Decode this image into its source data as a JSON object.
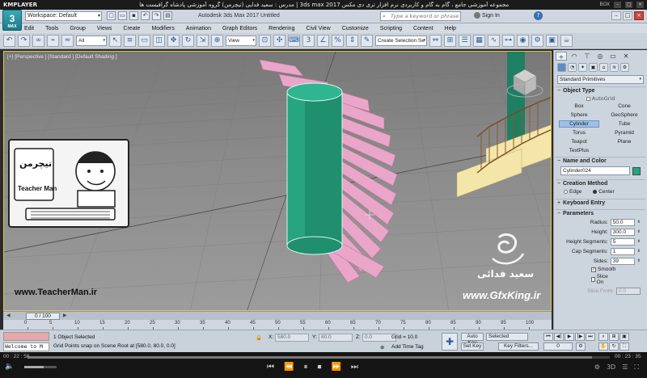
{
  "player": {
    "name": "KMPLAYER",
    "title": "مجموعه آموزشی جامع ، گام به گام و کاربردی نرم افزار تری دی مکس 3ds max 2017 | مدرس : سعید فدایی (تیچرمن) گروه آموزشی پادشاه گرافیست ها",
    "box_label": "BOX",
    "elapsed": "00 : 22 : 58",
    "total": "00 : 23 : 35",
    "progress": 0.97
  },
  "max": {
    "logo": "3",
    "logo_sub": "MAX",
    "workspace": "Workspace: Default",
    "app_title": "Autodesk 3ds Max 2017      Untitled",
    "search_placeholder": "Type a keyword or phrase",
    "sign_in": "Sign In"
  },
  "menu": [
    "Edit",
    "Tools",
    "Group",
    "Views",
    "Create",
    "Modifiers",
    "Animation",
    "Graph Editors",
    "Rendering",
    "Civil View",
    "Customize",
    "Scripting",
    "Content",
    "Help"
  ],
  "toolbar": {
    "filter": "All",
    "ref_coord": "View",
    "selection_set": "Create Selection Se"
  },
  "viewport": {
    "label": "[+] [Perspective ] [Standard ] [Default Shading ]"
  },
  "watermark": {
    "card_brand": "تیچرمن",
    "card_title": "Teacher Man",
    "url_left": "www.TeacherMan.ir",
    "name_right": "سعید فدائی",
    "url_right": "www.GfxKing.ir"
  },
  "panel": {
    "category": "Standard Primitives",
    "object_type_title": "Object Type",
    "autogrid": "AutoGrid",
    "primitives": [
      "Box",
      "Cone",
      "Sphere",
      "GeoSphere",
      "Cylinder",
      "Tube",
      "Torus",
      "Pyramid",
      "Teapot",
      "Plane",
      "TextPlus"
    ],
    "selected_primitive": "Cylinder",
    "name_color_title": "Name and Color",
    "object_name": "Cylinder024",
    "object_color": "#1fa784",
    "creation_method_title": "Creation Method",
    "creation_edge": "Edge",
    "creation_center": "Center",
    "keyboard_entry_title": "Keyboard Entry",
    "parameters_title": "Parameters",
    "params": [
      {
        "label": "Radius:",
        "value": "50.0"
      },
      {
        "label": "Height:",
        "value": "300.0"
      },
      {
        "label": "Height Segments:",
        "value": "5"
      },
      {
        "label": "Cap Segments:",
        "value": "1"
      },
      {
        "label": "Sides:",
        "value": "39"
      }
    ],
    "smooth": "Smooth",
    "slice_on": "Slice On",
    "slice_from_label": "Slice From:",
    "slice_from_value": "0.0"
  },
  "timeline": {
    "frame": "0 / 100",
    "ticks": [
      "0",
      "5",
      "10",
      "15",
      "20",
      "25",
      "30",
      "35",
      "40",
      "45",
      "50",
      "55",
      "60",
      "65",
      "70",
      "75",
      "80",
      "85",
      "90",
      "95",
      "100"
    ]
  },
  "status": {
    "maxscript_text": "Welcome to M",
    "selected": "1 Object Selected",
    "prompt": "Grid Points snap on Scene Root at [580.0, 80.0, 0.0]",
    "x_label": "X:",
    "x_value": "580.0",
    "y_label": "Y:",
    "y_value": "80.0",
    "z_label": "Z:",
    "z_value": "0.0",
    "grid": "Grid = 10.0",
    "add_time_tag": "Add Time Tag",
    "auto_key": "Auto Key",
    "selected_dd": "Selected",
    "set_key": "Set Key",
    "key_filters": "Key Filters...",
    "current_frame": "0"
  }
}
